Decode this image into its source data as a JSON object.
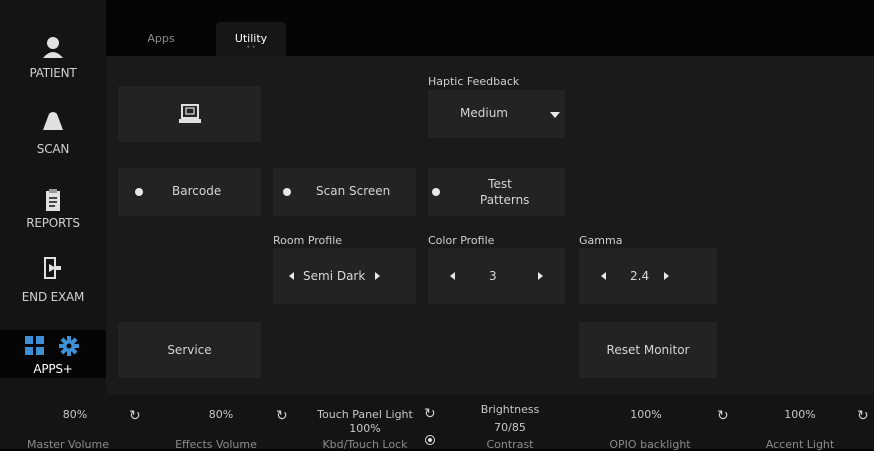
{
  "sidebar": {
    "items": [
      {
        "label": "PATIENT",
        "icon": "patient-icon"
      },
      {
        "label": "SCAN",
        "icon": "scan-icon"
      },
      {
        "label": "REPORTS",
        "icon": "reports-icon"
      },
      {
        "label": "END EXAM",
        "icon": "end-exam-icon"
      },
      {
        "label": "APPS+",
        "icon": "apps-icon"
      }
    ]
  },
  "tabs": [
    {
      "label": "Apps"
    },
    {
      "label": "Utility"
    }
  ],
  "utility": {
    "haptic": {
      "label": "Haptic Feedback",
      "value": "Medium"
    },
    "barcode_label": "Barcode",
    "scan_screen_label": "Scan Screen",
    "test_patterns_label": "Test Patterns",
    "room_profile": {
      "label": "Room Profile",
      "value": "Semi Dark"
    },
    "color_profile": {
      "label": "Color Profile",
      "value": "3"
    },
    "gamma": {
      "label": "Gamma",
      "value": "2.4"
    },
    "service_label": "Service",
    "reset_monitor_label": "Reset Monitor"
  },
  "bottom": {
    "master_volume": {
      "value": "80%",
      "label": "Master Volume"
    },
    "effects_volume": {
      "value": "80%",
      "label": "Effects Volume"
    },
    "touch_panel": {
      "label": "Touch Panel Light",
      "value": "100%",
      "sublabel": "Kbd/Touch Lock"
    },
    "brightness": {
      "label": "Brightness",
      "value": "70/85",
      "sublabel": "Contrast"
    },
    "opio": {
      "value": "100%",
      "label": "OPIO backlight"
    },
    "accent": {
      "value": "100%",
      "label": "Accent Light"
    }
  },
  "colors": {
    "background": "#050505",
    "panel": "#1a1a1a",
    "button": "#232323",
    "accent_blue": "#3d8fd6"
  }
}
